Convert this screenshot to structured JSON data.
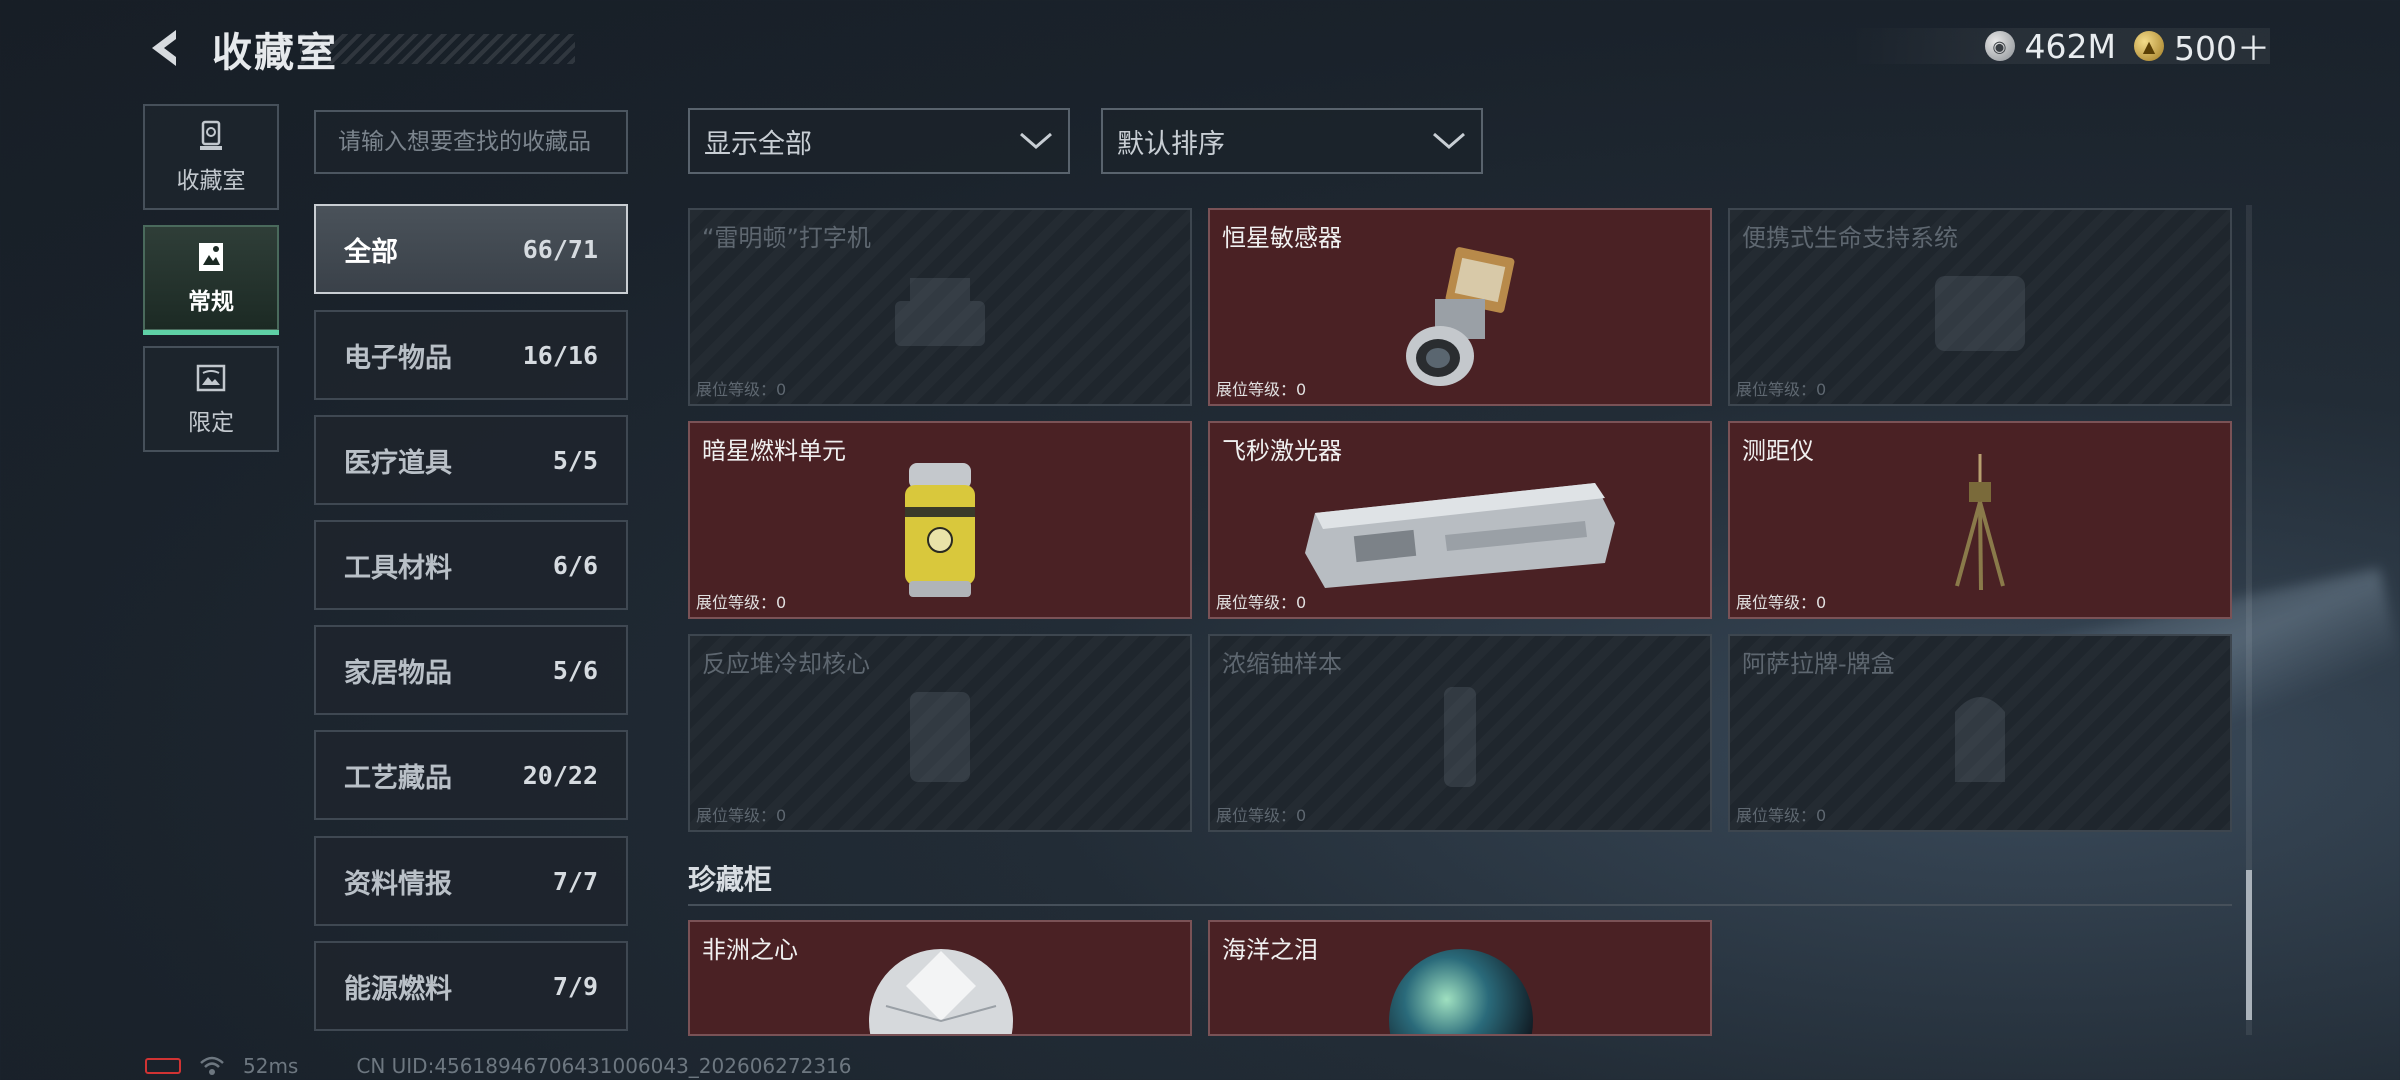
{
  "header": {
    "title": "收藏室",
    "currencies": [
      {
        "icon": "silver-coin-icon",
        "amount": "462M"
      },
      {
        "icon": "gold-coin-icon",
        "amount": "500＋"
      }
    ]
  },
  "sidebar": {
    "tabs": [
      {
        "label": "收藏室",
        "icon": "trophy-icon",
        "active": false
      },
      {
        "label": "常规",
        "icon": "frame-icon",
        "active": true
      },
      {
        "label": "限定",
        "icon": "picture-icon",
        "active": false
      }
    ]
  },
  "search": {
    "placeholder": "请输入想要查找的收藏品"
  },
  "categories": [
    {
      "name": "全部",
      "count": "66/71",
      "active": true
    },
    {
      "name": "电子物品",
      "count": "16/16"
    },
    {
      "name": "医疗道具",
      "count": "5/5"
    },
    {
      "name": "工具材料",
      "count": "6/6"
    },
    {
      "name": "家居物品",
      "count": "5/6"
    },
    {
      "name": "工艺藏品",
      "count": "20/22"
    },
    {
      "name": "资料情报",
      "count": "7/7"
    },
    {
      "name": "能源燃料",
      "count": "7/9"
    }
  ],
  "filters": {
    "display": "显示全部",
    "sort": "默认排序"
  },
  "items": [
    {
      "name": "“雷明顿”打字机",
      "level": "展位等级：0",
      "owned": false,
      "icon": "typewriter-icon"
    },
    {
      "name": "恒星敏感器",
      "level": "展位等级：0",
      "owned": true,
      "icon": "star-sensor-icon"
    },
    {
      "name": "便携式生命支持系统",
      "level": "展位等级：0",
      "owned": false,
      "icon": "life-support-icon"
    },
    {
      "name": "暗星燃料单元",
      "level": "展位等级：0",
      "owned": true,
      "icon": "fuel-canister-icon"
    },
    {
      "name": "飞秒激光器",
      "level": "展位等级：0",
      "owned": true,
      "icon": "laser-device-icon"
    },
    {
      "name": "测距仪",
      "level": "展位等级：0",
      "owned": true,
      "icon": "rangefinder-tripod-icon"
    },
    {
      "name": "反应堆冷却核心",
      "level": "展位等级：0",
      "owned": false,
      "icon": "reactor-core-icon"
    },
    {
      "name": "浓缩铀样本",
      "level": "展位等级：0",
      "owned": false,
      "icon": "uranium-sample-icon"
    },
    {
      "name": "阿萨拉牌-牌盒",
      "level": "展位等级：0",
      "owned": false,
      "icon": "card-box-icon"
    }
  ],
  "showcase": {
    "title": "珍藏柜",
    "items": [
      {
        "name": "非洲之心",
        "icon": "diamond-icon"
      },
      {
        "name": "海洋之泪",
        "icon": "pearl-orb-icon"
      }
    ]
  },
  "footer": {
    "ping": "52ms",
    "uid": "CN UID:456189467064310060​43_202606272316"
  },
  "colors": {
    "owned_bg": "#4a2124",
    "accent": "#5fd0a6"
  }
}
